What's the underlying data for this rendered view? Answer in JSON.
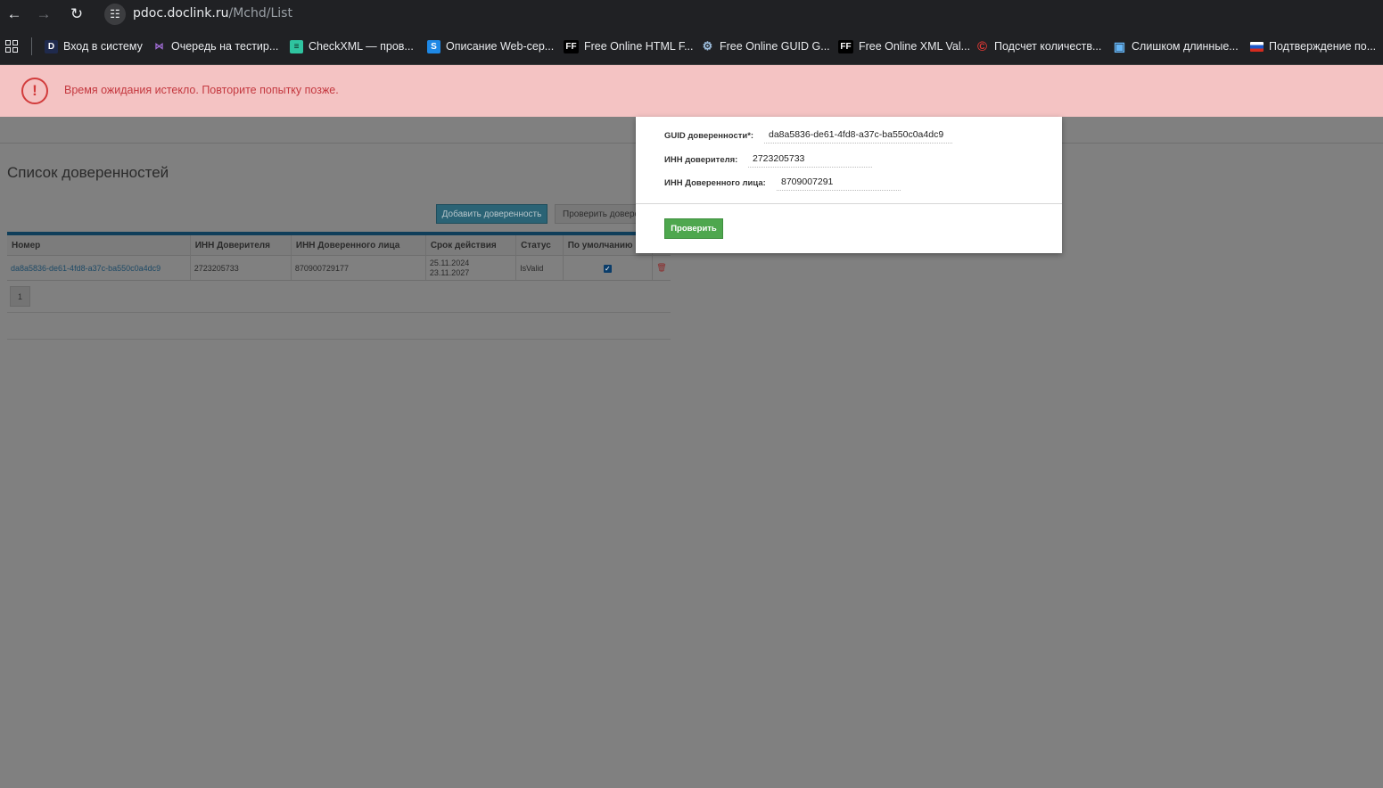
{
  "browser": {
    "url_host": "pdoc.doclink.ru",
    "url_path": "/Mchd/List",
    "back_glyph": "←",
    "forward_glyph": "→",
    "reload_glyph": "↻",
    "site_icon_glyph": "☷"
  },
  "bookmarks": [
    {
      "label": "Вход в систему",
      "icon": "D",
      "color": "#4a6cf7"
    },
    {
      "label": "Очередь на тестир...",
      "icon": "⋈",
      "color": "#a06cd5"
    },
    {
      "label": "CheckXML — пров...",
      "icon": "≡",
      "color": "#2fc4a0"
    },
    {
      "label": "Описание Web-сер...",
      "icon": "S",
      "color": "#1e88e5"
    },
    {
      "label": "Free Online HTML F...",
      "icon": "FF",
      "color": "#ffffff"
    },
    {
      "label": "Free Online GUID G...",
      "icon": "⚙",
      "color": "#9fc0e0"
    },
    {
      "label": "Free Online XML Val...",
      "icon": "FF",
      "color": "#ffffff"
    },
    {
      "label": "Подсчет количеств...",
      "icon": "©",
      "color": "#e53935"
    },
    {
      "label": "Слишком длинные...",
      "icon": "▣",
      "color": "#64b5f6"
    },
    {
      "label": "Подтверждение по...",
      "icon": "▬",
      "color": "#d52b1e"
    }
  ],
  "alert": {
    "icon": "!",
    "message": "Время ожидания истекло. Повторите попытку позже."
  },
  "page": {
    "title": "Список доверенностей",
    "add_button": "Добавить доверенность",
    "check_button": "Проверить доверенность"
  },
  "table": {
    "headers": [
      "Номер",
      "ИНН Доверителя",
      "ИНН Доверенного лица",
      "Срок действия",
      "Статус",
      "По умолчанию"
    ],
    "rows": [
      {
        "number": "da8a5836-de61-4fd8-a37c-ba550c0a4dc9",
        "inn_principal": "2723205733",
        "inn_agent": "870900729177",
        "valid_from": "25.11.2024",
        "valid_to": "23.11.2027",
        "status": "IsValid",
        "default": "✓",
        "delete_icon": "🗑"
      }
    ],
    "pager": [
      "1"
    ]
  },
  "modal": {
    "guid_label": "GUID доверенности*:",
    "guid_value": "da8a5836-de61-4fd8-a37c-ba550c0a4dc9",
    "inn_principal_label": "ИНН доверителя:",
    "inn_principal_value": "2723205733",
    "inn_agent_label": "ИНН Доверенного лица:",
    "inn_agent_value": "8709007291",
    "verify_button": "Проверить"
  }
}
